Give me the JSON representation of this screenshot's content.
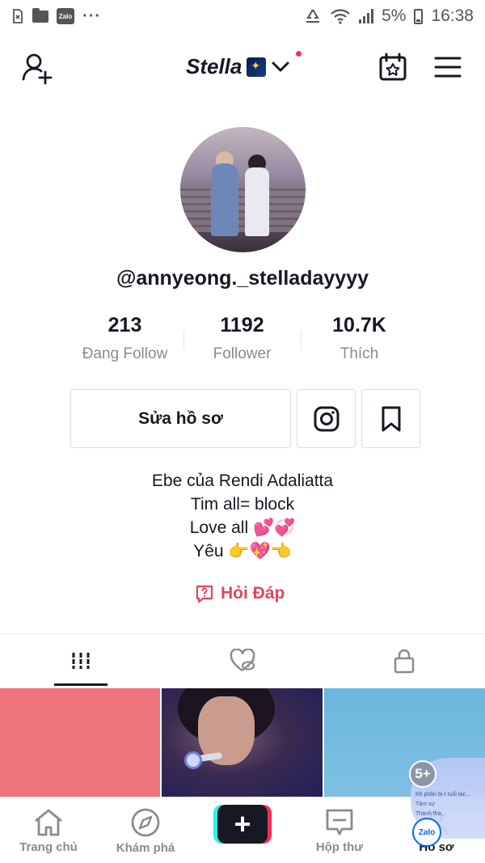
{
  "status_bar": {
    "app_badge": "Zalo",
    "more": "···",
    "battery_percent": "5%",
    "time": "16:38"
  },
  "header": {
    "title": "Stella"
  },
  "profile": {
    "username": "@annyeong._stelladayyyy",
    "stats": [
      {
        "value": "213",
        "label": "Đang Follow"
      },
      {
        "value": "1192",
        "label": "Follower"
      },
      {
        "value": "10.7K",
        "label": "Thích"
      }
    ],
    "edit_label": "Sửa hồ sơ",
    "bio": [
      "Ebe của Rendi Adaliatta",
      "Tim all= block",
      "Love all 💕💞",
      "Yêu 👉💖👈"
    ],
    "qa_label": "Hỏi Đáp"
  },
  "tabs": [
    {
      "icon": "grid-icon",
      "active": true
    },
    {
      "icon": "liked-hidden-icon",
      "active": false
    },
    {
      "icon": "lock-icon",
      "active": false
    }
  ],
  "floating_chat": {
    "count": "5+",
    "preview": [
      "Kh phân bi·t tuổi tác...",
      "Tâm sự",
      "Thành tha..."
    ],
    "logo": "Zalo"
  },
  "bottom_nav": [
    {
      "label": "Trang chủ",
      "icon": "home-icon"
    },
    {
      "label": "Khám phá",
      "icon": "compass-icon"
    },
    {
      "label": "",
      "icon": "plus-icon"
    },
    {
      "label": "Hộp thư",
      "icon": "inbox-icon"
    },
    {
      "label": "Hồ sơ",
      "icon": "profile-icon",
      "active": true
    }
  ],
  "colors": {
    "accent": "#fe2c55",
    "qa": "#e2455e",
    "text": "#161823",
    "muted": "#8a8b91"
  }
}
